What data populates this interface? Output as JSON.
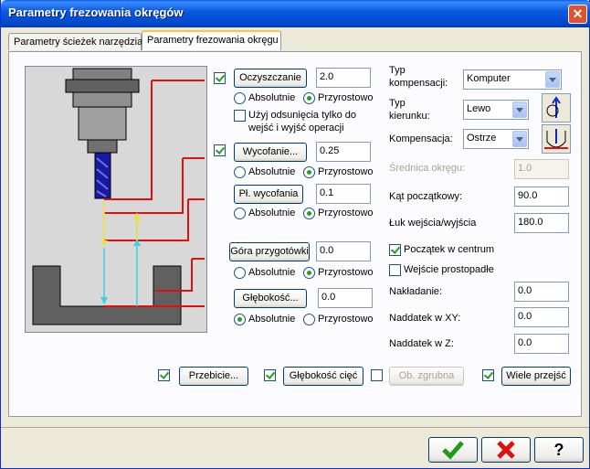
{
  "window": {
    "title": "Parametry frezowania okręgów"
  },
  "tabs": [
    {
      "label": "Parametry ścieżek narzędzia",
      "active": false
    },
    {
      "label": "Parametry frezowania okręgu",
      "active": true
    }
  ],
  "clearance": {
    "button": "Oczyszczanie",
    "checked": true,
    "value": "2.0",
    "absolute": "Absolutnie",
    "incremental": "Przyrostowo",
    "mode": "incremental"
  },
  "use_clearance_only": {
    "label_line1": "Użyj odsunięcia tylko do",
    "label_line2": "wejść i wyjść operacji",
    "checked": false
  },
  "retract": {
    "button": "Wycofanie...",
    "checked": true,
    "value": "0.25",
    "absolute": "Absolutnie",
    "incremental": "Przyrostowo",
    "mode": "incremental"
  },
  "feed_plane": {
    "button": "Pł. wycofania",
    "value": "0.1",
    "absolute": "Absolutnie",
    "incremental": "Przyrostowo",
    "mode": "incremental"
  },
  "top_of_stock": {
    "button": "Góra przygotówki",
    "value": "0.0",
    "absolute": "Absolutnie",
    "incremental": "Przyrostowo",
    "mode": "incremental"
  },
  "depth": {
    "button": "Głębokość...",
    "value": "0.0",
    "absolute": "Absolutnie",
    "incremental": "Przyrostowo",
    "mode": "absolute"
  },
  "compensation_type": {
    "label_line1": "Typ",
    "label_line2": "kompensacji:",
    "value": "Komputer"
  },
  "direction_type": {
    "label_line1": "Typ",
    "label_line2": "kierunku:",
    "value": "Lewo"
  },
  "compensation": {
    "label": "Kompensacja:",
    "value": "Ostrze"
  },
  "circle_diameter": {
    "label": "Średnica okręgu:",
    "value": "1.0"
  },
  "start_angle": {
    "label": "Kąt początkowy:",
    "value": "90.0"
  },
  "entry_exit_arc": {
    "label": "Łuk wejścia/wyjścia",
    "value": "180.0"
  },
  "start_at_center": {
    "label": "Początek w centrum",
    "checked": true
  },
  "perpendicular_entry": {
    "label": "Wejście prostopadłe",
    "checked": false
  },
  "overlap": {
    "label": "Nakładanie:",
    "value": "0.0"
  },
  "xy_stock": {
    "label": "Naddatek w XY:",
    "value": "0.0"
  },
  "z_stock": {
    "label": "Naddatek w Z:",
    "value": "0.0"
  },
  "bottom_options": [
    {
      "label": "Przebicie...",
      "checked": true,
      "enabled": true
    },
    {
      "label": "Głębokość cięć",
      "checked": true,
      "enabled": true
    },
    {
      "label": "Ob. zgrubna",
      "checked": false,
      "enabled": false
    },
    {
      "label": "Wiele przejść",
      "checked": true,
      "enabled": true
    }
  ],
  "dialog_buttons": {
    "ok_icon": "checkmark-icon",
    "cancel_icon": "x-icon",
    "help_icon": "question-icon",
    "help_glyph": "?"
  },
  "colors": {
    "accent_red": "#E01010",
    "cyan": "#3AD3E0",
    "yellow": "#F0E030",
    "tool_blue": "#1818A0",
    "title_blue": "#0A5AE0"
  }
}
